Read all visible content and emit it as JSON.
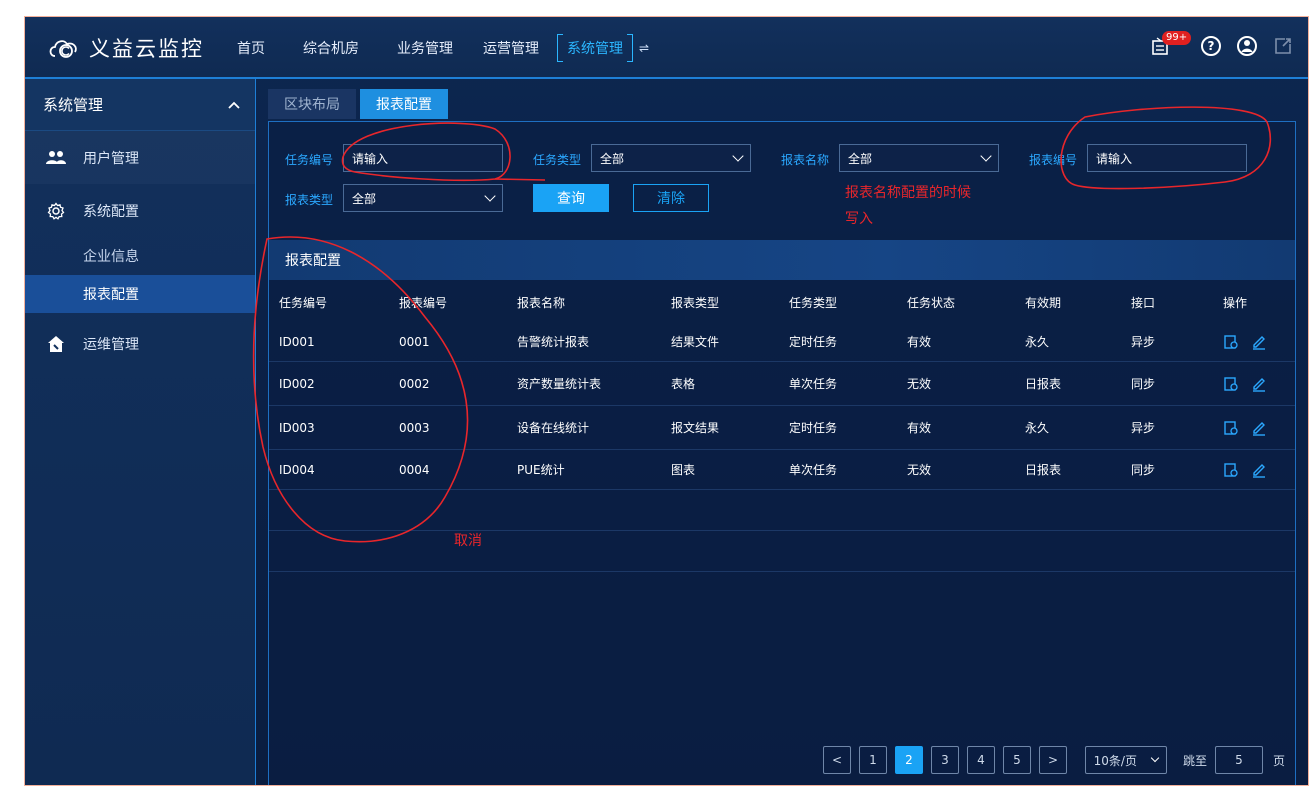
{
  "app": {
    "title": "义益云监控"
  },
  "nav": {
    "items": [
      "首页",
      "综合机房",
      "业务管理",
      "运营管理"
    ],
    "active": "系统管理",
    "swap_glyph": "⇌",
    "notification_badge": "99+"
  },
  "sidebar": {
    "header": "系统管理",
    "items": {
      "users": "用户管理",
      "config": "系统配置",
      "company": "企业信息",
      "report": "报表配置",
      "ops": "运维管理"
    }
  },
  "tabs": [
    "区块布局",
    "报表配置"
  ],
  "filter": {
    "task_id_label": "任务编号",
    "task_id_value": "请输入",
    "task_type_label": "任务类型",
    "task_type_value": "全部",
    "report_name_label": "报表名称",
    "report_name_value": "全部",
    "report_no_label": "报表编号",
    "report_no_value": "请输入",
    "report_type_label": "报表类型",
    "report_type_value": "全部",
    "query_button": "查询",
    "clear_button": "清除"
  },
  "annotations": {
    "note1_line1": "报表名称配置的时候",
    "note1_line2": "写入",
    "note2": "取消"
  },
  "section_title": "报表配置",
  "table": {
    "headers": [
      "任务编号",
      "报表编号",
      "报表名称",
      "报表类型",
      "任务类型",
      "任务状态",
      "有效期",
      "接口",
      "操作"
    ],
    "rows": [
      [
        "ID001",
        "0001",
        "告警统计报表",
        "结果文件",
        "定时任务",
        "有效",
        "永久",
        "异步"
      ],
      [
        "ID002",
        "0002",
        "资产数量统计表",
        "表格",
        "单次任务",
        "无效",
        "日报表",
        "同步"
      ],
      [
        "ID003",
        "0003",
        "设备在线统计",
        "报文结果",
        "定时任务",
        "有效",
        "永久",
        "异步"
      ],
      [
        "ID004",
        "0004",
        "PUE统计",
        "图表",
        "单次任务",
        "无效",
        "日报表",
        "同步"
      ]
    ]
  },
  "pagination": {
    "pages": [
      "1",
      "2",
      "3",
      "4",
      "5"
    ],
    "current": "2",
    "page_size": "10条/页",
    "jump_label": "跳至",
    "jump_value": "5",
    "page_suffix": "页",
    "prev": "<",
    "next": ">"
  },
  "colors": {
    "accent": "#1aa3f5",
    "annotation": "#e8262b",
    "background": "#0b2148"
  }
}
